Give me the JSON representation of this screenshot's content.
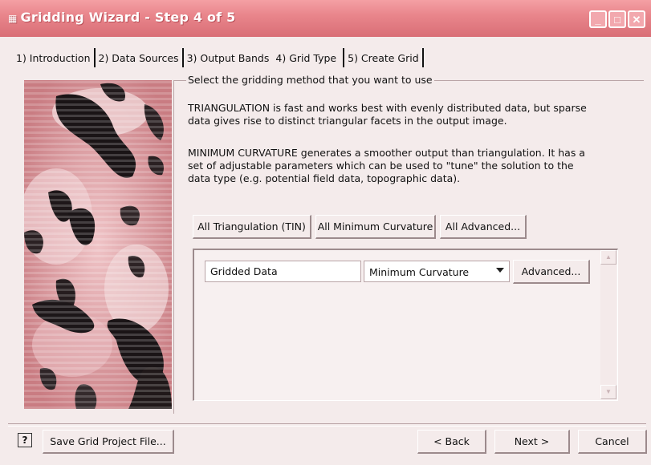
{
  "window": {
    "title": "Gridding Wizard - Step 4 of 5",
    "title_icon": "app-icon"
  },
  "tabs": [
    {
      "label": "1) Introduction",
      "active": false
    },
    {
      "label": "2) Data Sources",
      "active": false
    },
    {
      "label": "3) Output Bands",
      "active": false
    },
    {
      "label": "4) Grid Type",
      "active": true
    },
    {
      "label": "5) Create Grid",
      "active": false
    }
  ],
  "group": {
    "title": "Select the gridding method that you want to use"
  },
  "description": {
    "triangulation": "TRIANGULATION is fast and works best with evenly distributed data, but sparse data gives rise to distinct triangular facets in the output image.",
    "min_curvature": "MINIMUM CURVATURE generates a smoother output than triangulation. It has a set of adjustable parameters which can be used to \"tune\" the solution to the data type (e.g. potential field data, topographic data)."
  },
  "method_buttons": {
    "all_triangulation": "All Triangulation (TIN)",
    "all_min_curvature": "All Minimum Curvature",
    "all_advanced": "All Advanced..."
  },
  "grid_rows": [
    {
      "name": "Gridded Data",
      "method": "Minimum Curvature",
      "advanced_label": "Advanced..."
    }
  ],
  "footer": {
    "help_icon": "help-icon",
    "save_label": "Save Grid Project File...",
    "back_label": "< Back",
    "next_label": "Next >",
    "cancel_label": "Cancel"
  },
  "colors": {
    "titlebar": "#e9868c",
    "background": "#f4ebeb"
  }
}
